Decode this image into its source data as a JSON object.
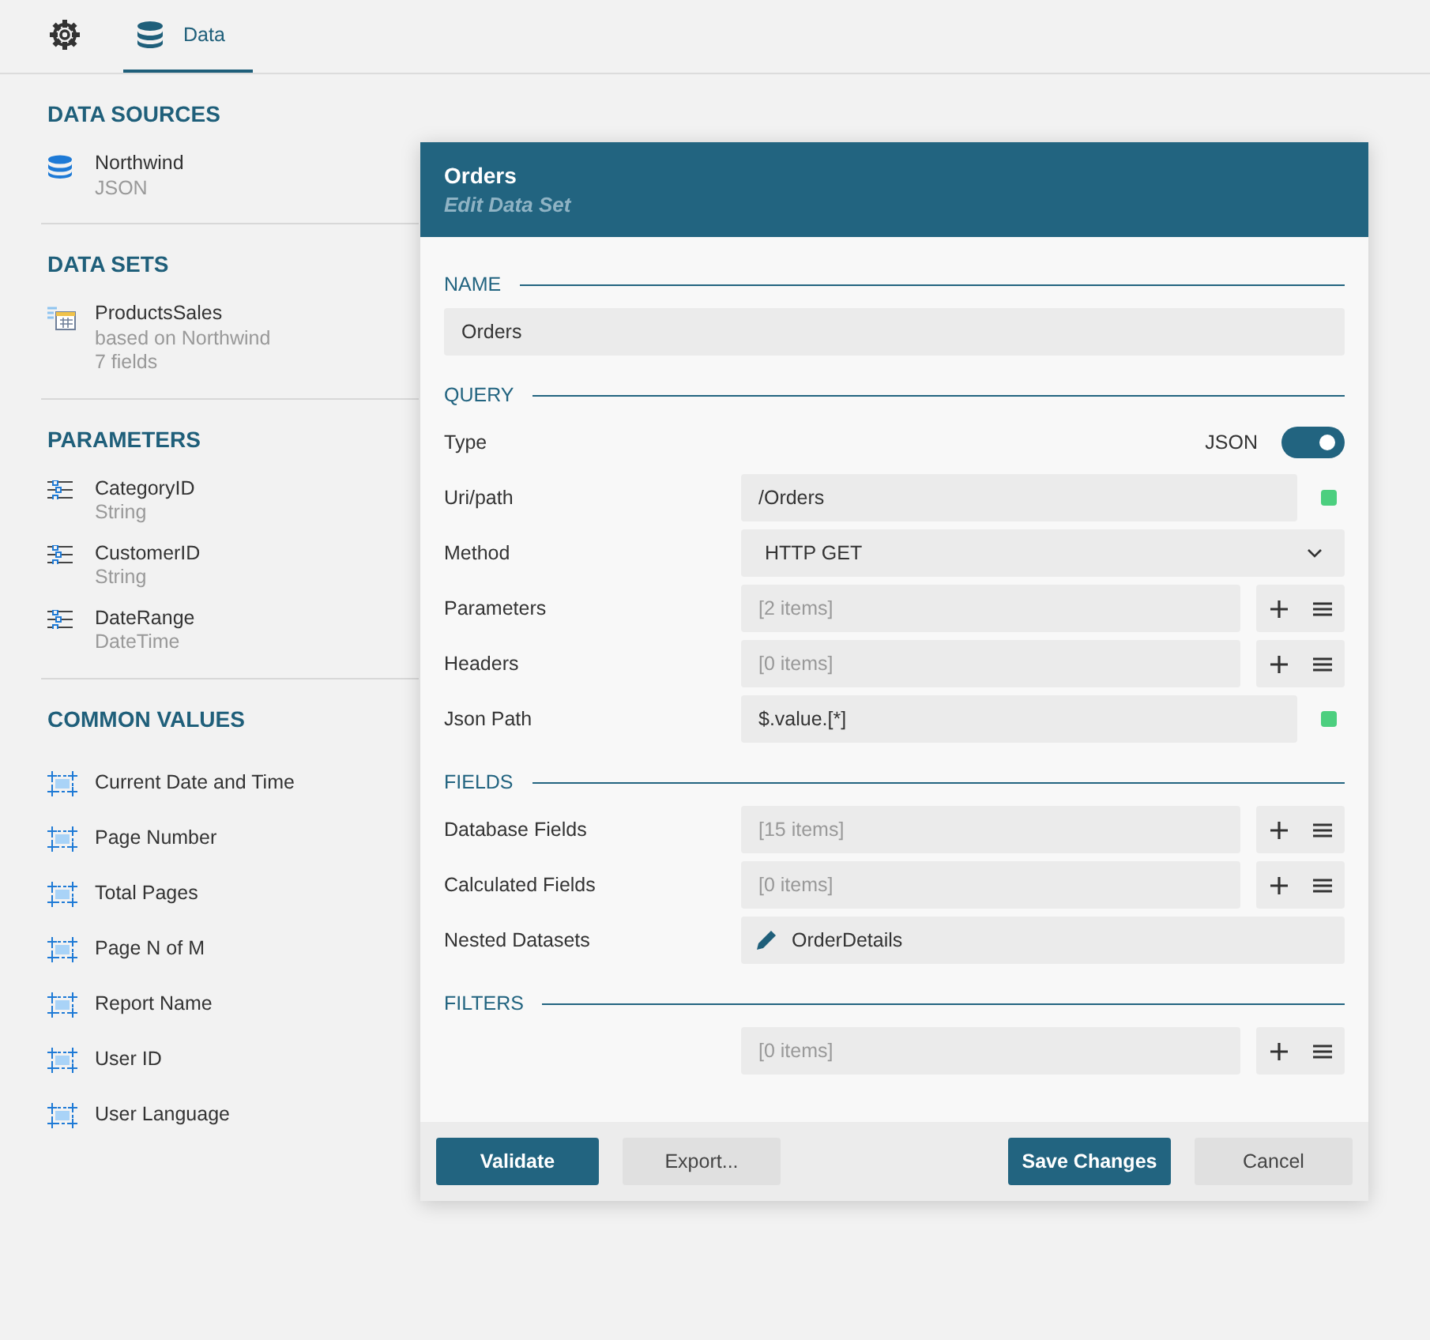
{
  "tabs": [
    {
      "kind": "settings",
      "selected": false
    },
    {
      "kind": "data",
      "label": "Data",
      "selected": true
    }
  ],
  "sidebar": {
    "sections": [
      {
        "heading": "DATA SOURCES",
        "items": [
          {
            "kind": "source",
            "title": "Northwind",
            "lines": [
              "JSON"
            ]
          }
        ]
      },
      {
        "heading": "DATA SETS",
        "items": [
          {
            "kind": "dataset",
            "title": "ProductsSales",
            "lines": [
              "based on Northwind",
              "7 fields"
            ]
          }
        ]
      },
      {
        "heading": "PARAMETERS",
        "items": [
          {
            "kind": "parameter",
            "title": "CategoryID",
            "lines": [
              "String"
            ]
          },
          {
            "kind": "parameter",
            "title": "CustomerID",
            "lines": [
              "String"
            ]
          },
          {
            "kind": "parameter",
            "title": "DateRange",
            "lines": [
              "DateTime"
            ]
          }
        ]
      },
      {
        "heading": "COMMON VALUES",
        "items": [
          {
            "kind": "value",
            "title": "Current Date and Time"
          },
          {
            "kind": "value",
            "title": "Page Number"
          },
          {
            "kind": "value",
            "title": "Total Pages"
          },
          {
            "kind": "value",
            "title": "Page N of M"
          },
          {
            "kind": "value",
            "title": "Report Name"
          },
          {
            "kind": "value",
            "title": "User ID"
          },
          {
            "kind": "value",
            "title": "User Language"
          }
        ]
      }
    ]
  },
  "dialog": {
    "title": "Orders",
    "subtitle": "Edit Data Set",
    "sections": [
      {
        "heading": "NAME",
        "rows": [
          {
            "kind": "text",
            "value": "Orders"
          }
        ]
      },
      {
        "heading": "QUERY",
        "rows": [
          {
            "kind": "toggle",
            "label": "Type",
            "value": "JSON",
            "on": true
          },
          {
            "kind": "text",
            "label": "Uri/path",
            "value": "/Orders",
            "valid": true
          },
          {
            "kind": "select",
            "label": "Method",
            "value": "HTTP GET"
          },
          {
            "kind": "collection",
            "label": "Parameters",
            "value": "[2 items]"
          },
          {
            "kind": "collection",
            "label": "Headers",
            "value": "[0 items]"
          },
          {
            "kind": "text",
            "label": "Json Path",
            "value": "$.value.[*]",
            "valid": true
          }
        ]
      },
      {
        "heading": "FIELDS",
        "rows": [
          {
            "kind": "collection",
            "label": "Database Fields",
            "value": "[15 items]"
          },
          {
            "kind": "collection",
            "label": "Calculated Fields",
            "value": "[0 items]"
          },
          {
            "kind": "link",
            "label": "Nested Datasets",
            "value": "OrderDetails"
          }
        ]
      },
      {
        "heading": "FILTERS",
        "rows": [
          {
            "kind": "collection",
            "value": "[0 items]"
          }
        ]
      }
    ],
    "buttons": [
      {
        "label": "Validate",
        "kind": "primary"
      },
      {
        "label": "Export...",
        "kind": "secondary"
      },
      {
        "label": "Save Changes",
        "kind": "primary"
      },
      {
        "label": "Cancel",
        "kind": "secondary"
      }
    ]
  }
}
